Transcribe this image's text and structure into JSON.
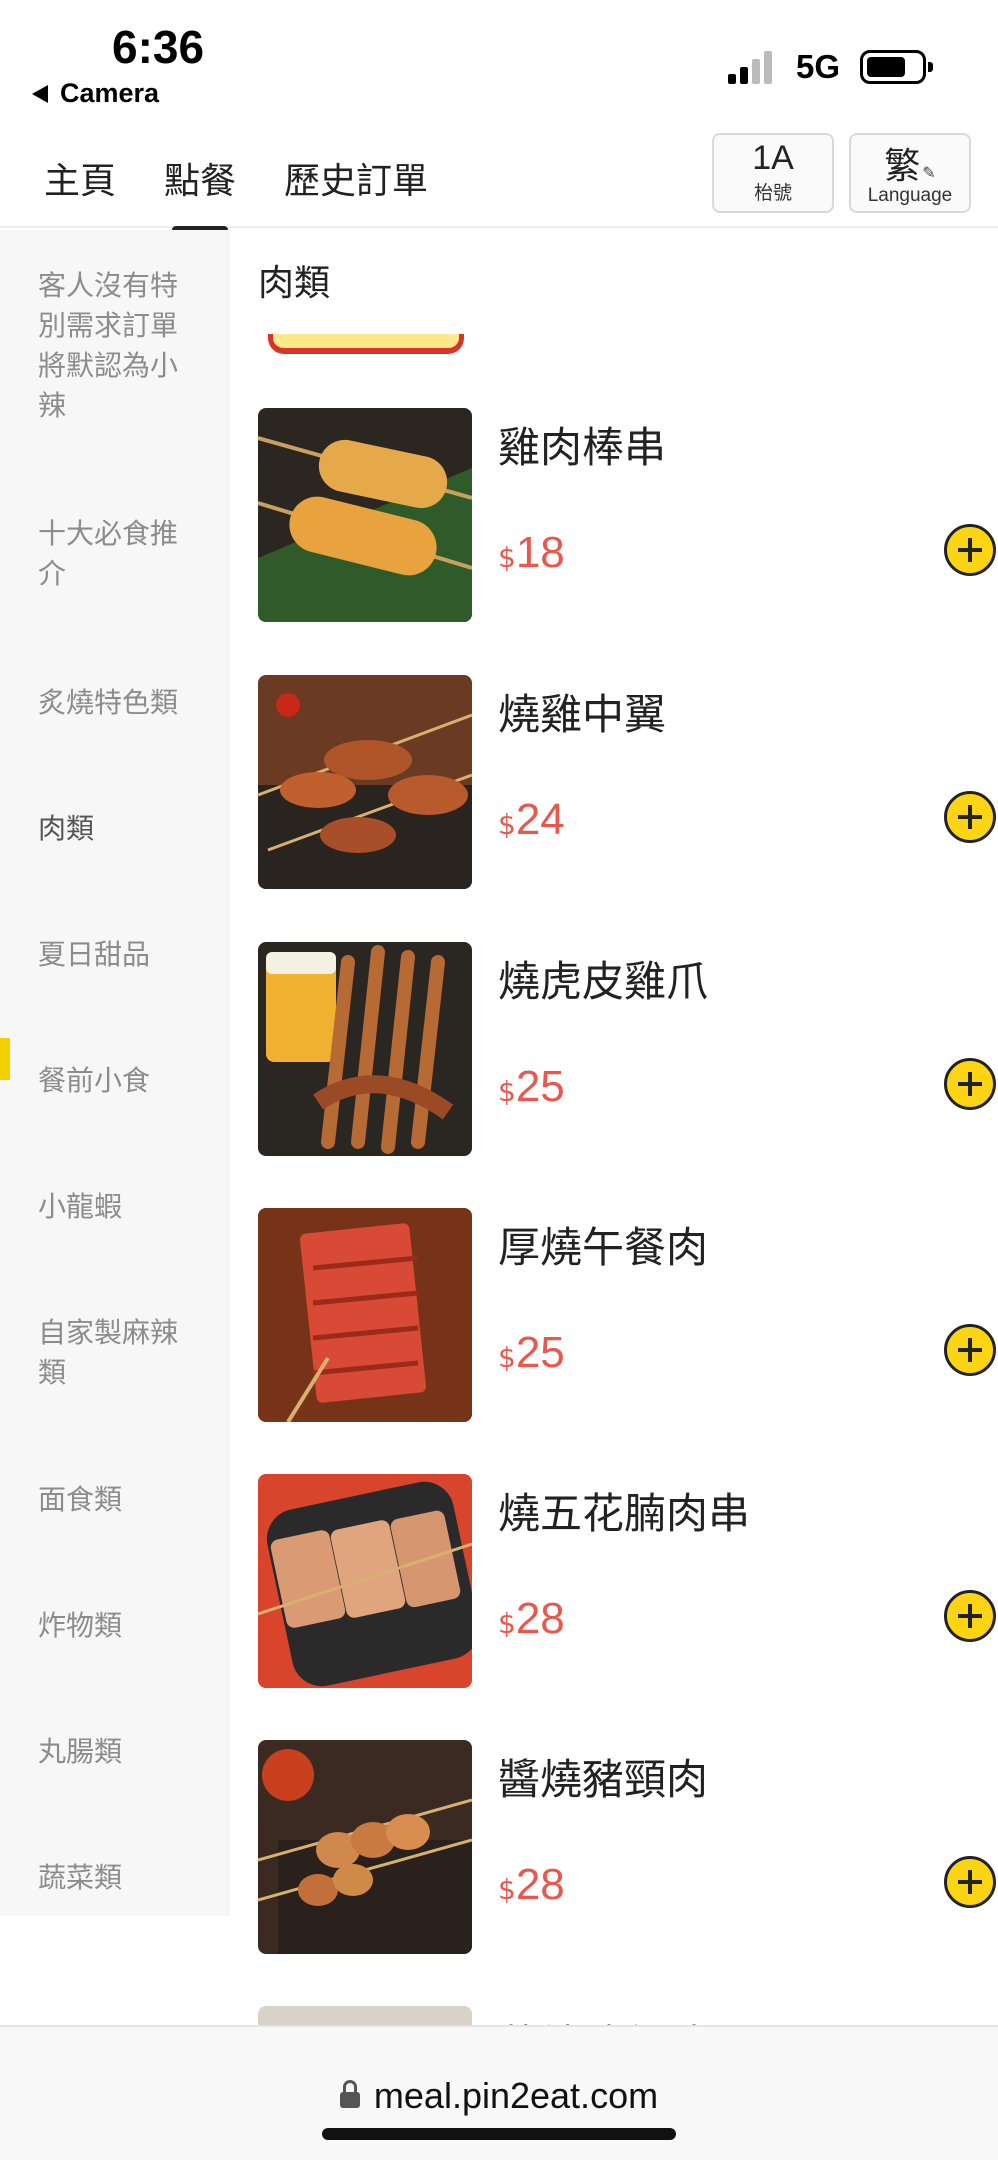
{
  "status_bar": {
    "time": "6:36",
    "back_app": "Camera",
    "network": "5G",
    "icons": [
      "signal-icon",
      "battery-icon"
    ]
  },
  "nav": {
    "tabs": [
      {
        "label": "主頁",
        "active": false
      },
      {
        "label": "點餐",
        "active": true
      },
      {
        "label": "歷史訂單",
        "active": false
      }
    ],
    "table": {
      "number": "1A",
      "label": "枱號"
    },
    "language": {
      "current": "繁",
      "label": "Language",
      "icon": "pencil-icon"
    }
  },
  "sidebar": {
    "categories": [
      {
        "label": "客人沒有特別需求訂單將默認為小辣",
        "active": false
      },
      {
        "label": "十大必食推介",
        "active": false
      },
      {
        "label": "炙燒特色類",
        "active": false
      },
      {
        "label": "肉類",
        "active": true
      },
      {
        "label": "夏日甜品",
        "active": false
      },
      {
        "label": "餐前小食",
        "active": false
      },
      {
        "label": "小龍蝦",
        "active": false
      },
      {
        "label": "自家製麻辣類",
        "active": false
      },
      {
        "label": "面食類",
        "active": false
      },
      {
        "label": "炸物類",
        "active": false
      },
      {
        "label": "丸腸類",
        "active": false
      },
      {
        "label": "蔬菜類",
        "active": false
      }
    ]
  },
  "content": {
    "section_title": "肉類",
    "currency": "$",
    "items": [
      {
        "name": "雞肉棒串",
        "price": "18",
        "image": "chicken-skewer-photo"
      },
      {
        "name": "燒雞中翼",
        "price": "24",
        "image": "chicken-wing-photo"
      },
      {
        "name": "燒虎皮雞爪",
        "price": "25",
        "image": "chicken-feet-photo"
      },
      {
        "name": "厚燒午餐肉",
        "price": "25",
        "image": "luncheon-meat-photo"
      },
      {
        "name": "燒五花腩肉串",
        "price": "28",
        "image": "pork-belly-photo"
      },
      {
        "name": "醬燒豬頸肉",
        "price": "28",
        "image": "pork-neck-photo"
      },
      {
        "name": "醬燒豬仔髀",
        "price": "",
        "image": "pork-leg-photo"
      }
    ],
    "add_icon": "plus-circle-icon"
  },
  "url_bar": {
    "url": "meal.pin2eat.com",
    "icon": "lock-icon"
  }
}
